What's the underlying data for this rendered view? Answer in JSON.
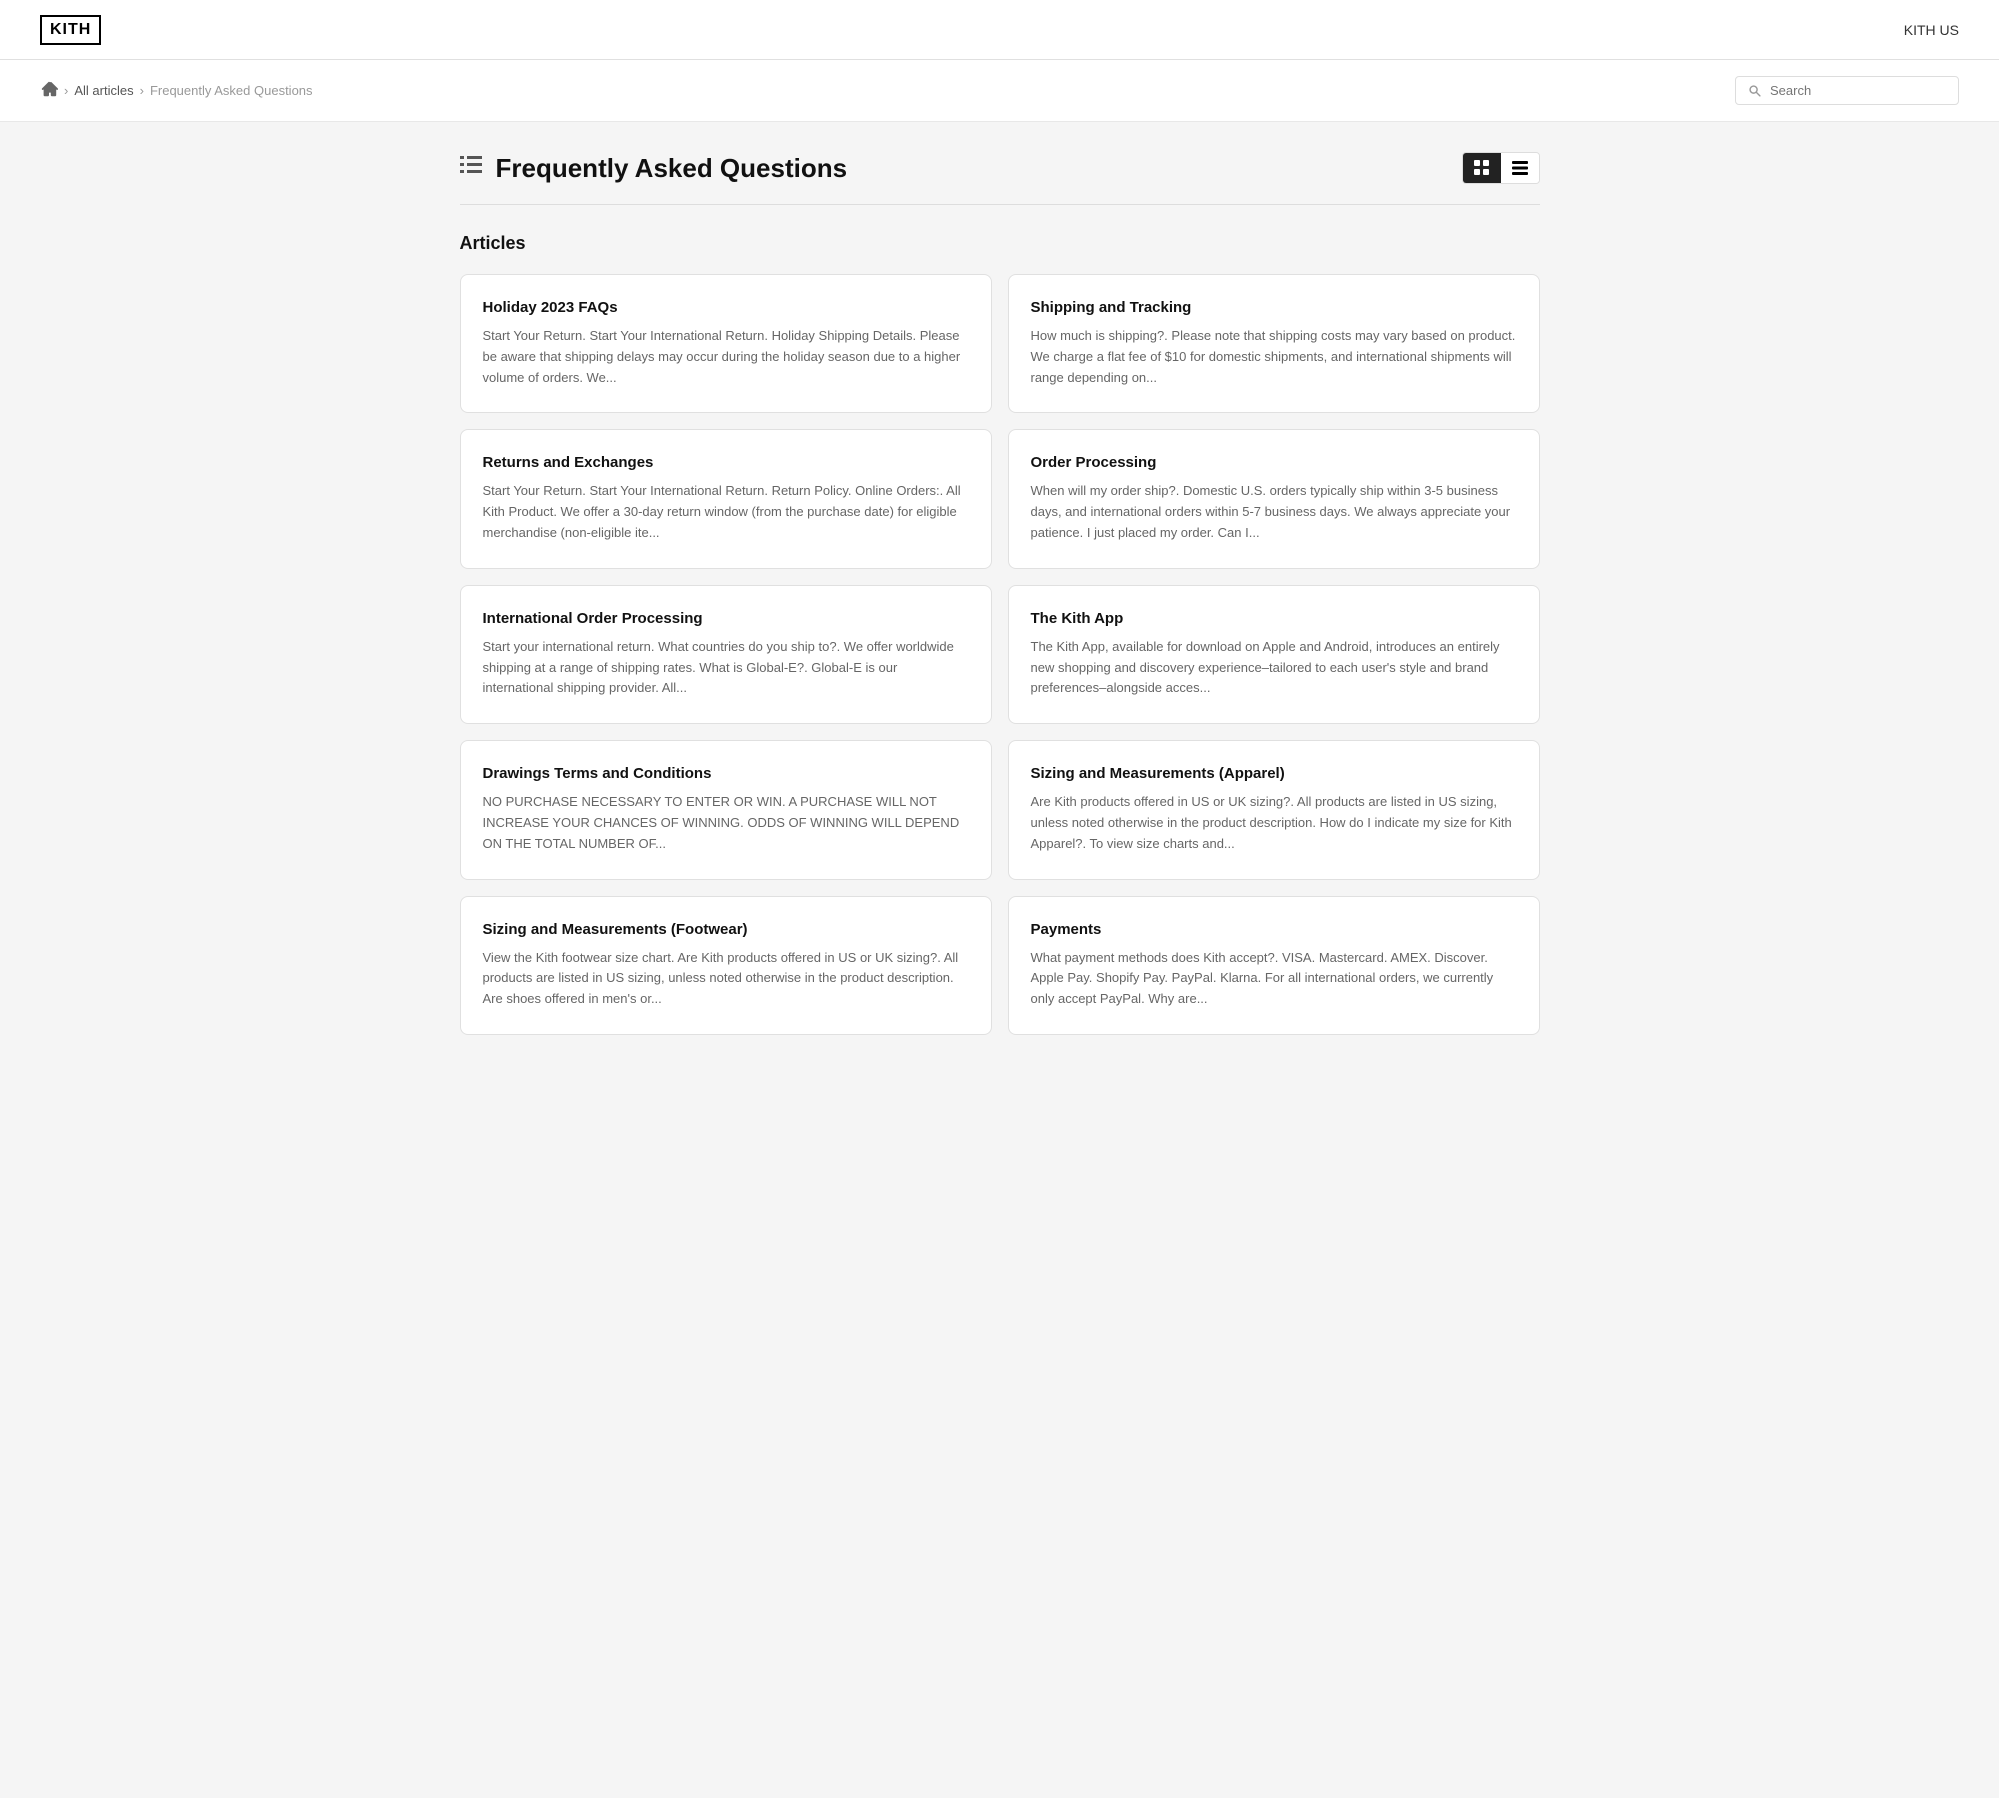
{
  "header": {
    "logo": "KITH",
    "nav_link": "KITH US"
  },
  "breadcrumb": {
    "home_label": "Home",
    "all_articles_label": "All articles",
    "current_label": "Frequently Asked Questions"
  },
  "search": {
    "placeholder": "Search"
  },
  "page": {
    "title": "Frequently Asked Questions",
    "toc_icon": "≡",
    "grid_view_label": "Grid view",
    "list_view_label": "List view"
  },
  "articles_section": {
    "heading": "Articles",
    "articles": [
      {
        "title": "Holiday 2023 FAQs",
        "excerpt": "Start Your Return. Start Your International Return. Holiday Shipping Details. Please be aware that shipping delays may occur during the holiday season due to a higher volume of orders. We..."
      },
      {
        "title": "Shipping and Tracking",
        "excerpt": "How much is shipping?. Please note that shipping costs may vary based on product. We charge a flat fee of $10 for domestic shipments, and international shipments will range depending on..."
      },
      {
        "title": "Returns and Exchanges",
        "excerpt": "Start Your Return. Start Your International Return. Return Policy. Online Orders:. All Kith Product. We offer a 30-day return window (from the purchase date) for eligible merchandise (non-eligible ite..."
      },
      {
        "title": "Order Processing",
        "excerpt": "When will my order ship?. Domestic U.S. orders typically ship within 3-5 business days, and international orders within 5-7 business days. We always appreciate your patience. I just placed my order. Can I..."
      },
      {
        "title": "International Order Processing",
        "excerpt": "Start your international return. What countries do you ship to?. We offer worldwide shipping at a range of shipping rates. What is Global-E?. Global-E is our international shipping provider. All..."
      },
      {
        "title": "The Kith App",
        "excerpt": "The Kith App, available for download on Apple and Android, introduces an entirely new shopping and discovery experience–tailored to each user's style and brand preferences–alongside acces..."
      },
      {
        "title": "Drawings Terms and Conditions",
        "excerpt": "NO PURCHASE NECESSARY TO ENTER OR WIN.  A PURCHASE WILL NOT INCREASE YOUR CHANCES OF WINNING. ODDS OF WINNING WILL DEPEND ON THE TOTAL NUMBER OF..."
      },
      {
        "title": "Sizing and Measurements (Apparel)",
        "excerpt": "Are Kith products offered in US or UK sizing?. All products are listed in US sizing, unless noted otherwise in the product description. How do I indicate my size for Kith Apparel?. To view size charts and..."
      },
      {
        "title": "Sizing and Measurements (Footwear)",
        "excerpt": "View the Kith footwear size chart. Are Kith products offered in US or UK sizing?. All products are listed in US sizing, unless noted otherwise in the product description. Are shoes offered in men's or..."
      },
      {
        "title": "Payments",
        "excerpt": "What payment methods does Kith accept?. VISA. Mastercard. AMEX. Discover. Apple Pay. Shopify Pay. PayPal. Klarna. For all international orders, we currently only accept PayPal. Why are..."
      }
    ]
  }
}
